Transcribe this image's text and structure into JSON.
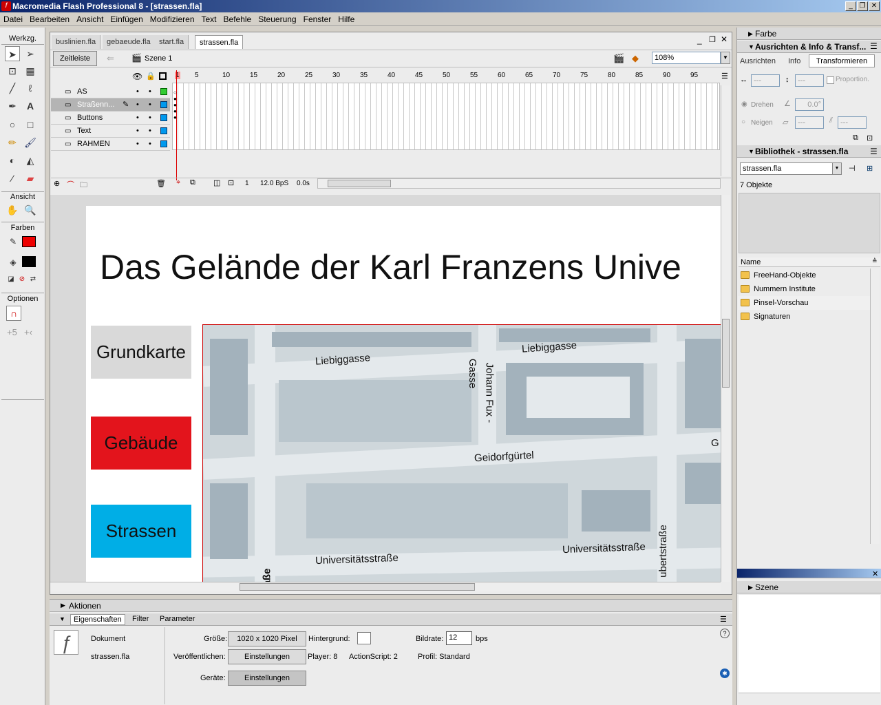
{
  "window": {
    "title": "Macromedia Flash Professional 8 - [strassen.fla]",
    "app_icon": "flash-logo-icon"
  },
  "menu": [
    "Datei",
    "Bearbeiten",
    "Ansicht",
    "Einfügen",
    "Modifizieren",
    "Text",
    "Befehle",
    "Steuerung",
    "Fenster",
    "Hilfe"
  ],
  "tools": {
    "title": "Werkzg.",
    "view_label": "Ansicht",
    "colors_label": "Farben",
    "options_label": "Optionen"
  },
  "doc_tabs": [
    "buslinien.fla",
    "gebaeude.fla",
    "start.fla",
    "strassen.fla"
  ],
  "editbar": {
    "timeline_button": "Zeitleiste",
    "scene": "Szene 1",
    "zoom": "108%"
  },
  "timeline": {
    "layers": [
      "AS",
      "Straßenn...",
      "Buttons",
      "Text",
      "RAHMEN"
    ],
    "frame_numbers": [
      "1",
      "5",
      "10",
      "15",
      "20",
      "25",
      "30",
      "35",
      "40",
      "45",
      "50",
      "55",
      "60",
      "65",
      "70",
      "75",
      "80",
      "85",
      "90",
      "95"
    ],
    "current_frame": "1",
    "fps": "12.0 BpS",
    "elapsed": "0.0s"
  },
  "stage": {
    "title": "Das Gelände der Karl Franzens Unive",
    "buttons": [
      {
        "label": "Grundkarte",
        "color": "#d9d9d9"
      },
      {
        "label": "Gebäude",
        "color": "#e3141c"
      },
      {
        "label": "Strassen",
        "color": "#00aee6"
      }
    ],
    "streets": [
      "Liebiggasse",
      "Liebiggasse",
      "Johann Fux -",
      "Gasse",
      "Geidorfgürtel",
      "G",
      "Universitätsstraße",
      "Universitätsstraße",
      "ubertstraße",
      "aße"
    ]
  },
  "panels": {
    "color": "Farbe",
    "align": "Ausrichten & Info & Transf...",
    "align_tabs": [
      "Ausrichten",
      "Info",
      "Transformieren"
    ],
    "transform": {
      "proportional": "Proportion.",
      "rotate": "Drehen",
      "rotate_value": "0.0°",
      "skew": "Neigen",
      "empty": "---"
    },
    "library": {
      "title": "Bibliothek - strassen.fla",
      "file": "strassen.fla",
      "count": "7 Objekte",
      "name_col": "Name",
      "items": [
        "FreeHand-Objekte",
        "Nummern Institute",
        "Pinsel-Vorschau",
        "Signaturen"
      ]
    },
    "scene": "Szene"
  },
  "properties": {
    "actions": "Aktionen",
    "tabs": [
      "Eigenschaften",
      "Filter",
      "Parameter"
    ],
    "doc_label": "Dokument",
    "doc_name": "strassen.fla",
    "size_label": "Größe:",
    "size_value": "1020 x 1020 Pixel",
    "bg_label": "Hintergrund:",
    "framerate_label": "Bildrate:",
    "framerate_value": "12",
    "framerate_unit": "bps",
    "publish_label": "Veröffentlichen:",
    "settings": "Einstellungen",
    "player": "Player:  8",
    "actionscript": "ActionScript:   2",
    "profile": "Profil:  Standard",
    "devices_label": "Geräte:",
    "devices_button": "Einstellungen"
  }
}
